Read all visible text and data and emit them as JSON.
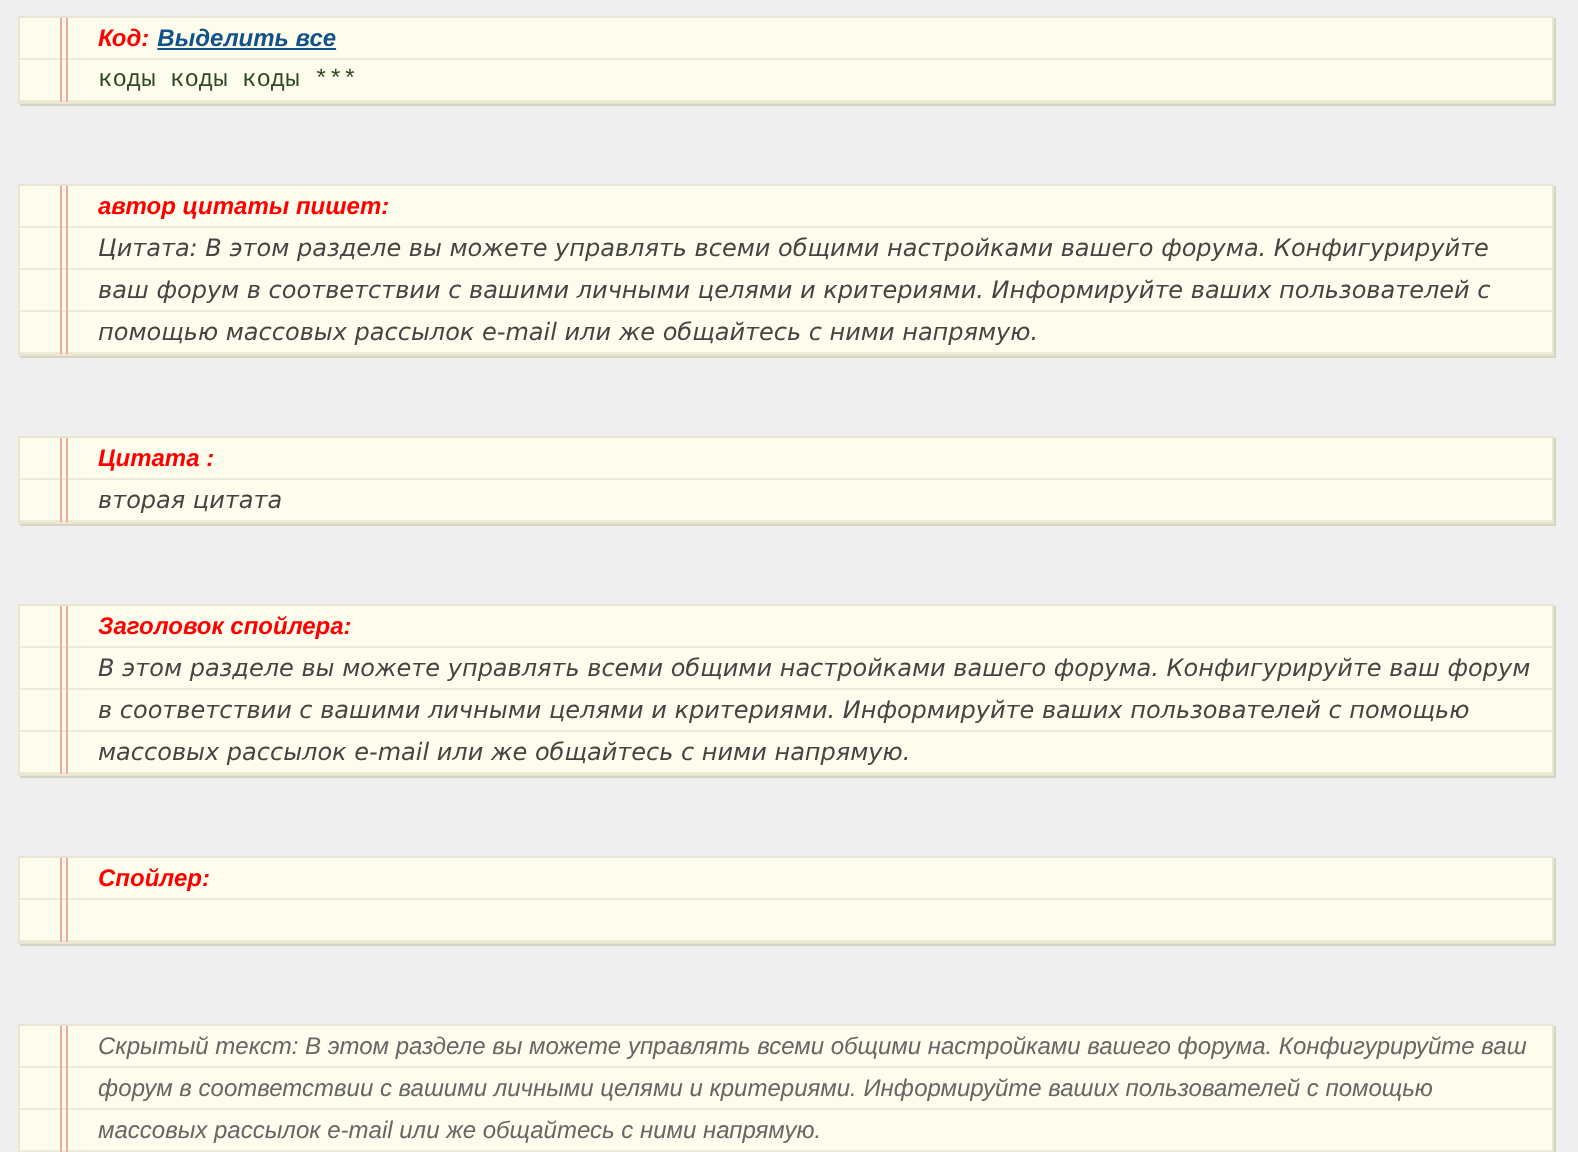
{
  "blocks": [
    {
      "kind": "code",
      "title": "Код:",
      "link": "Выделить все",
      "body": "коды коды коды ***"
    },
    {
      "kind": "quote",
      "title": "автор цитаты пишет:",
      "body": "Цитата: В этом разделе вы можете управлять всеми общими настройками вашего форума. Конфигурируйте ваш форум в соответствии с вашими личными целями и критериями. Информируйте ваших пользователей с помощью массовых рассылок e-mail или же общайтесь с ними напрямую."
    },
    {
      "kind": "quote",
      "title": "Цитата :",
      "body": "вторая цитата"
    },
    {
      "kind": "spoiler",
      "title": "Заголовок спойлера:",
      "body": "В этом разделе вы можете управлять всеми общими настройками вашего форума. Конфигурируйте ваш форум в соответствии с вашими личными целями и критериями. Информируйте ваших пользователей с помощью массовых рассылок e-mail или же общайтесь с ними напрямую."
    },
    {
      "kind": "spoiler",
      "title": "Спойлер:"
    },
    {
      "kind": "hidden",
      "body": "Скрытый текст: В этом разделе вы можете управлять всеми общими настройками вашего форума. Конфигурируйте ваш форум в соответствии с вашими личными целями и критериями. Информируйте ваших пользователей с помощью массовых рассылок e-mail или же общайтесь с ними напрямую."
    }
  ]
}
